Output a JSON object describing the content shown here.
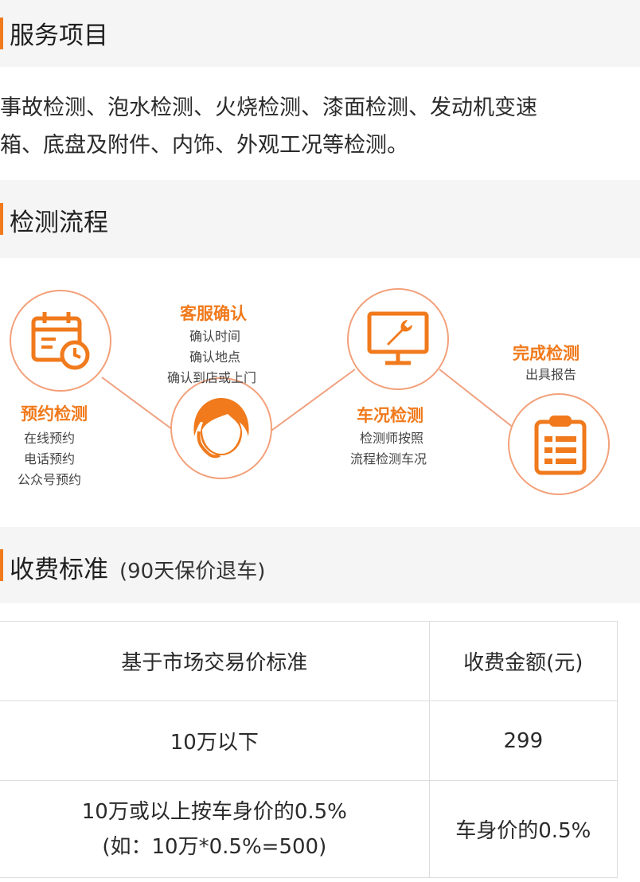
{
  "colors": {
    "accent": "#f07a1c",
    "circle_border": "#f3a07a",
    "header_bg": "#f5f5f5"
  },
  "service": {
    "title": "服务项目",
    "desc_line1": "事故检测、泡水检测、火烧检测、漆面检测、发动机变速",
    "desc_line2": "箱、底盘及附件、内饰、外观工况等检测。"
  },
  "process": {
    "title": "检测流程",
    "steps": [
      {
        "title": "预约检测",
        "lines": [
          "在线预约",
          "电话预约",
          "公众号预约"
        ],
        "icon": "calendar-clock-icon"
      },
      {
        "title": "客服确认",
        "lines": [
          "确认时间",
          "确认地点",
          "确认到店或上门"
        ],
        "icon": "customer-service-icon"
      },
      {
        "title": "车况检测",
        "lines": [
          "检测师按照",
          "流程检测车况"
        ],
        "icon": "monitor-wrench-icon"
      },
      {
        "title": "完成检测",
        "lines": [
          "出具报告"
        ],
        "icon": "clipboard-report-icon"
      }
    ]
  },
  "fees": {
    "title": "收费标准",
    "subtitle": "(90天保价退车)",
    "headers": [
      "基于市场交易价标准",
      "收费金额(元)"
    ],
    "rows": [
      {
        "range": [
          "10万以下"
        ],
        "amount": "299"
      },
      {
        "range": [
          "10万或以上按车身价的0.5%",
          "(如：10万*0.5%=500)"
        ],
        "amount": "车身价的0.5%"
      }
    ]
  }
}
